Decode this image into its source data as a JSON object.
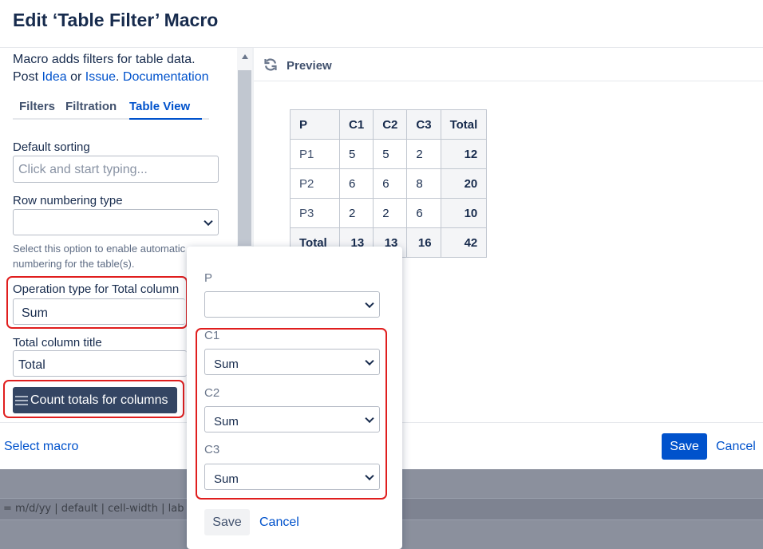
{
  "background": {
    "format_text": "= m/d/yy | default | cell-width | lab"
  },
  "dialog": {
    "title": "Edit ‘Table Filter’ Macro",
    "description": {
      "line1": "Macro adds filters for table data.",
      "post": "Post",
      "idea": "Idea",
      "or": "or",
      "issue": "Issue",
      "period": ".",
      "documentation": "Documentation"
    },
    "tabs": [
      "Filters",
      "Filtration",
      "Table View"
    ],
    "active_tab": "Table View",
    "fields": {
      "default_sorting_label": "Default sorting",
      "default_sorting_placeholder": "Click and start typing...",
      "row_numbering_label": "Row numbering type",
      "row_numbering_value": "",
      "row_numbering_help_1": "Select this option to enable automatic",
      "row_numbering_help_2": "numbering for the table(s).",
      "operation_label": "Operation type for Total column",
      "operation_value": "Sum",
      "total_title_label": "Total column title",
      "total_title_value": "Total"
    },
    "count_totals_button": "Count totals for columns",
    "preview": {
      "title": "Preview",
      "headers": [
        "P",
        "C1",
        "C2",
        "C3",
        "Total"
      ],
      "rows": [
        [
          "P1",
          "5",
          "5",
          "2",
          "12"
        ],
        [
          "P2",
          "6",
          "6",
          "8",
          "20"
        ],
        [
          "P3",
          "2",
          "2",
          "6",
          "10"
        ]
      ],
      "totals_row": [
        "Total",
        "13",
        "13",
        "16",
        "42"
      ]
    },
    "footer": {
      "select_macro": "Select macro",
      "save": "Save",
      "cancel": "Cancel"
    }
  },
  "popup": {
    "columns": [
      {
        "label": "P",
        "value": ""
      },
      {
        "label": "C1",
        "value": "Sum"
      },
      {
        "label": "C2",
        "value": "Sum"
      },
      {
        "label": "C3",
        "value": "Sum"
      }
    ],
    "save": "Save",
    "cancel": "Cancel"
  },
  "colors": {
    "accent": "#0052cc",
    "highlight": "#e01e1e",
    "dark_button": "#344563"
  }
}
